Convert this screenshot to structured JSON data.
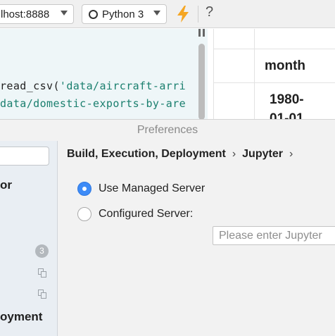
{
  "toolbar": {
    "server_url": "lhost:8888",
    "kernel": "Python 3",
    "help": "?"
  },
  "editor": {
    "line1_prefix": "read_csv(",
    "line1_string": "'data/aircraft-arri",
    "line2": "data/domestic-exports-by-are"
  },
  "output": {
    "column_header": "month",
    "cell_1": "1980-",
    "cell_2": "01-01"
  },
  "dialog": {
    "title": "Preferences",
    "sidebar": {
      "partial_item_top": "or",
      "badge_count": "3",
      "partial_item_bottom": "oyment"
    },
    "breadcrumb": {
      "item1": "Build, Execution, Deployment",
      "separator": "›",
      "item2": "Jupyter",
      "item3": "›"
    },
    "options": {
      "managed_label": "Use Managed Server",
      "configured_label": "Configured Server:",
      "url_placeholder": "Please enter Jupyter"
    }
  },
  "colors": {
    "accent": "#3d8bf7",
    "bolt": "#f5a623",
    "code_string": "#1a7f6e"
  }
}
